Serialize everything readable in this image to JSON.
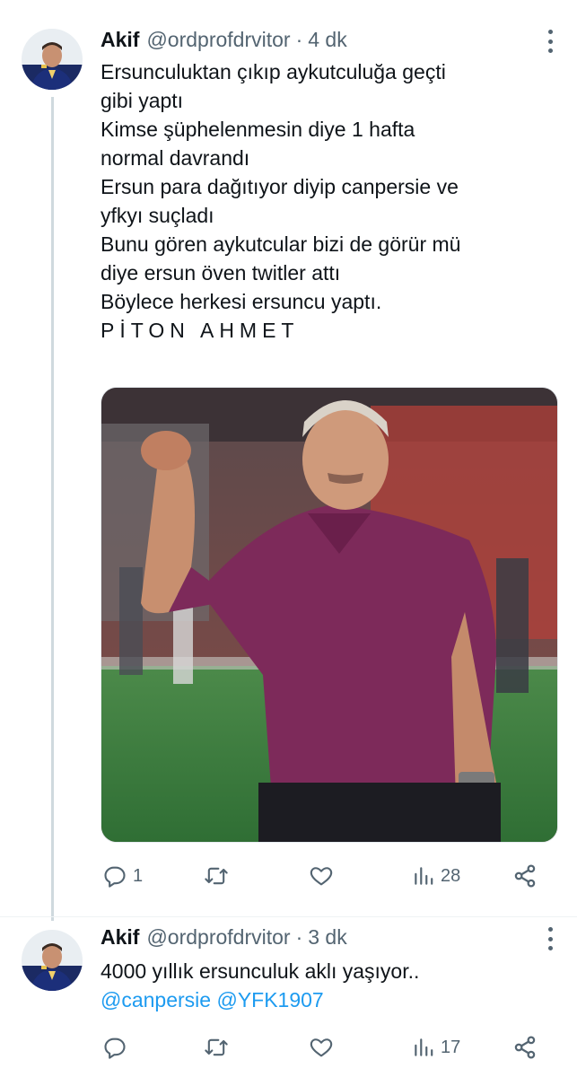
{
  "tweet1": {
    "author_name": "Akif",
    "author_handle": "@ordprofdrvitor",
    "separator": "·",
    "timestamp": "4 dk",
    "lines": [
      "Ersunculuktan çıkıp aykutculuğa geçti",
      "gibi yaptı",
      "Kimse şüphelenmesin diye 1 hafta",
      "normal davrandı",
      "Ersun para dağıtıyor diyip canpersie ve",
      "yfkyı suçladı",
      "Bunu gören aykutcular bizi de görür mü",
      "diye ersun öven twitler attı",
      "Böylece herkesi ersuncu yaptı.",
      "PİTON AHMET"
    ],
    "actions": {
      "reply_count": "1",
      "retweet_count": "",
      "like_count": "",
      "views_count": "28"
    }
  },
  "tweet2": {
    "author_name": "Akif",
    "author_handle": "@ordprofdrvitor",
    "separator": "·",
    "timestamp": "3 dk",
    "text": "4000 yıllık ersunculuk aklı yaşıyor..",
    "mentions": [
      "@canpersie",
      "@YFK1907"
    ],
    "actions": {
      "reply_count": "",
      "retweet_count": "",
      "like_count": "",
      "views_count": "17"
    }
  },
  "colors": {
    "text_primary": "#0f1419",
    "text_secondary": "#536471",
    "link": "#1d9bf0",
    "thread_line": "#cfd9de"
  },
  "icons": {
    "reply": "reply-icon",
    "retweet": "retweet-icon",
    "like": "heart-icon",
    "views": "views-icon",
    "share": "share-icon",
    "more": "more-icon"
  }
}
